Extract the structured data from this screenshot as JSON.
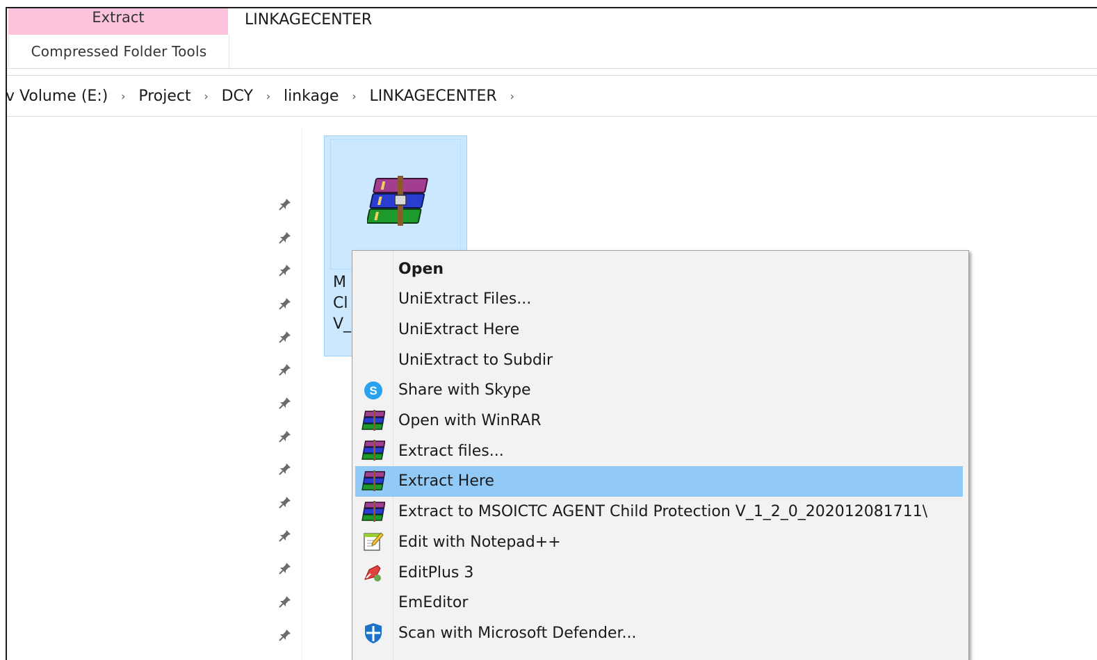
{
  "ribbon": {
    "context_tab": "Extract",
    "context_group": "Compressed Folder Tools",
    "window_title": "LINKAGECENTER"
  },
  "address": {
    "crumbs": [
      "v Volume (E:)",
      "Project",
      "DCY",
      "linkage",
      "LINKAGECENTER"
    ]
  },
  "file": {
    "name_lines": [
      "M",
      "Cl",
      "V_"
    ]
  },
  "menu": {
    "items": [
      {
        "label": "Open",
        "icon": "none",
        "bold": true
      },
      {
        "label": "UniExtract Files...",
        "icon": "none"
      },
      {
        "label": "UniExtract Here",
        "icon": "none"
      },
      {
        "label": "UniExtract to Subdir",
        "icon": "none"
      },
      {
        "label": "Share with Skype",
        "icon": "skype-icon"
      },
      {
        "label": "Open with WinRAR",
        "icon": "winrar-icon"
      },
      {
        "label": "Extract files...",
        "icon": "winrar-icon"
      },
      {
        "label": "Extract Here",
        "icon": "winrar-icon",
        "highlighted": true
      },
      {
        "label": "Extract to MSOICTC AGENT Child Protection V_1_2_0_202012081711\\",
        "icon": "winrar-icon"
      },
      {
        "label": "Edit with Notepad++",
        "icon": "notepad-plus-plus-icon"
      },
      {
        "label": "EditPlus 3",
        "icon": "editplus-icon"
      },
      {
        "label": "EmEditor",
        "icon": "none"
      },
      {
        "label": "Scan with Microsoft Defender...",
        "icon": "defender-icon"
      }
    ]
  },
  "colors": {
    "context_tab_bg": "#fbc3dc",
    "selection_bg": "#cce8ff",
    "menu_hover": "#91c9f7",
    "menu_bg": "#f2f2f2"
  }
}
